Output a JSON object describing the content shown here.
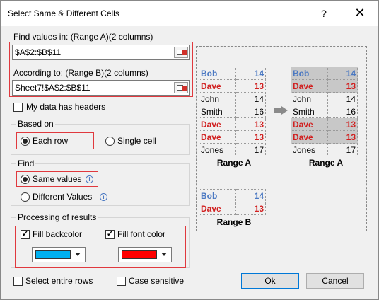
{
  "dialog": {
    "title": "Select Same & Different Cells",
    "help_glyph": "?",
    "close_glyph": "✕"
  },
  "find_values": {
    "label": "Find values in: (Range A)(2 columns)",
    "value": "$A$2:$B$11"
  },
  "according_to": {
    "label": "According to: (Range B)(2 columns)",
    "value": "Sheet7!$A$2:$B$11"
  },
  "headers_checkbox": {
    "label": "My data has headers",
    "checked": false
  },
  "based_on": {
    "title": "Based on",
    "each_row": "Each row",
    "single_cell": "Single cell",
    "selected": "each_row"
  },
  "find": {
    "title": "Find",
    "same_values": "Same values",
    "different_values": "Different Values",
    "selected": "same_values"
  },
  "processing": {
    "title": "Processing of results",
    "fill_backcolor": "Fill backcolor",
    "fill_font_color": "Fill font color",
    "backcolor_checked": true,
    "fontcolor_checked": true,
    "backcolor": "#00b0f0",
    "fontcolor": "#ff0000"
  },
  "select_entire_rows": {
    "label": "Select entire rows",
    "checked": false
  },
  "case_sensitive": {
    "label": "Case sensitive",
    "checked": false
  },
  "buttons": {
    "ok": "Ok",
    "cancel": "Cancel"
  },
  "preview": {
    "range_a_before": [
      {
        "name": "Bob",
        "value": "14",
        "style": "blue"
      },
      {
        "name": "Dave",
        "value": "13",
        "style": "red"
      },
      {
        "name": "John",
        "value": "14",
        "style": ""
      },
      {
        "name": "Smith",
        "value": "16",
        "style": ""
      },
      {
        "name": "Dave",
        "value": "13",
        "style": "red"
      },
      {
        "name": "Dave",
        "value": "13",
        "style": "red"
      },
      {
        "name": "Jones",
        "value": "17",
        "style": ""
      }
    ],
    "range_a_label": "Range A",
    "range_a_after": [
      {
        "name": "Bob",
        "value": "14",
        "style": "blue",
        "hl": true
      },
      {
        "name": "Dave",
        "value": "13",
        "style": "red",
        "hl": true
      },
      {
        "name": "John",
        "value": "14",
        "style": "",
        "hl": false
      },
      {
        "name": "Smith",
        "value": "16",
        "style": "",
        "hl": false
      },
      {
        "name": "Dave",
        "value": "13",
        "style": "red",
        "hl": true
      },
      {
        "name": "Dave",
        "value": "13",
        "style": "red",
        "hl": true
      },
      {
        "name": "Jones",
        "value": "17",
        "style": "",
        "hl": false
      }
    ],
    "range_a_after_label": "Range A",
    "range_b": [
      {
        "name": "Bob",
        "value": "14",
        "style": "blue"
      },
      {
        "name": "Dave",
        "value": "13",
        "style": "red"
      }
    ],
    "range_b_label": "Range B"
  },
  "colors": {
    "highlight_red": "#e0393e",
    "accent_blue": "#0078d7"
  }
}
